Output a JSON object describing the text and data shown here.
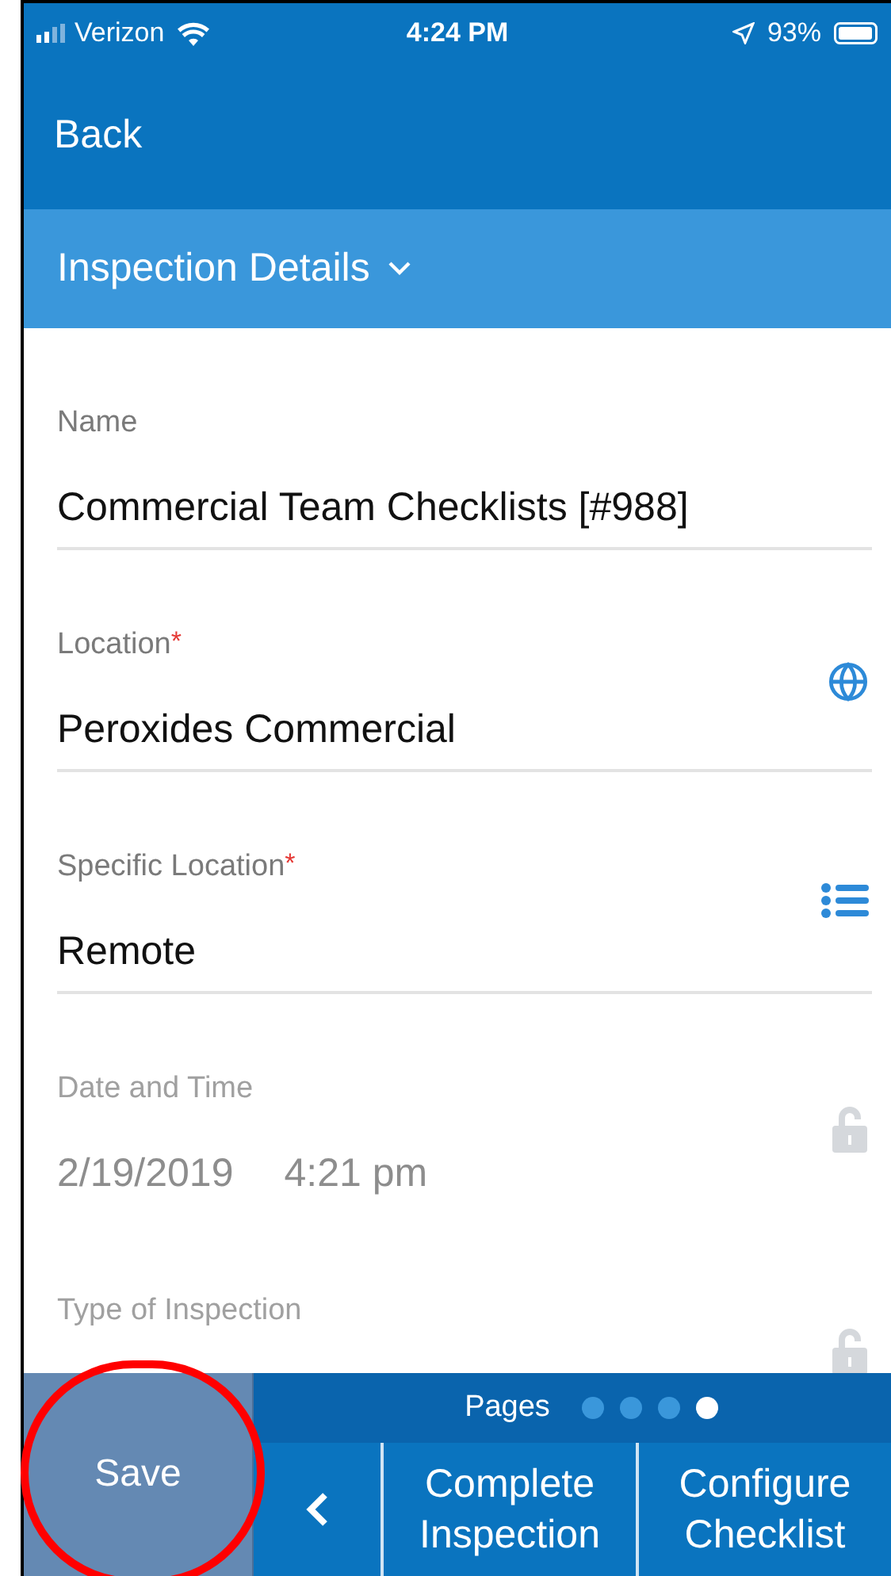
{
  "status_bar": {
    "carrier": "Verizon",
    "time": "4:24 PM",
    "battery": "93%"
  },
  "nav": {
    "back": "Back"
  },
  "section": {
    "title": "Inspection Details",
    "expanded": true
  },
  "fields": [
    {
      "kind": "text",
      "label": "Name",
      "values": [
        "Commercial Team Checklists [#988]"
      ],
      "locked": false
    },
    {
      "kind": "globe",
      "label": "Location",
      "required_mark": "*",
      "values": [
        "Peroxides Commercial"
      ],
      "locked": false
    },
    {
      "kind": "list",
      "label": "Specific Location",
      "required_mark": "*",
      "values": [
        "Remote"
      ],
      "locked": false
    },
    {
      "kind": "lock",
      "label": "Date and Time",
      "values": [
        "2/19/2019",
        "4:21 pm"
      ],
      "locked": true
    },
    {
      "kind": "lock",
      "label": "Type of Inspection",
      "locked": true
    }
  ],
  "bottom": {
    "save": "Save",
    "save_circled": true,
    "pages_label": "Pages",
    "pages": [
      {
        "selected": false
      },
      {
        "selected": false
      },
      {
        "selected": false
      },
      {
        "selected": true
      }
    ],
    "actions": [
      "Complete Inspection",
      "Configure Checklist"
    ]
  }
}
